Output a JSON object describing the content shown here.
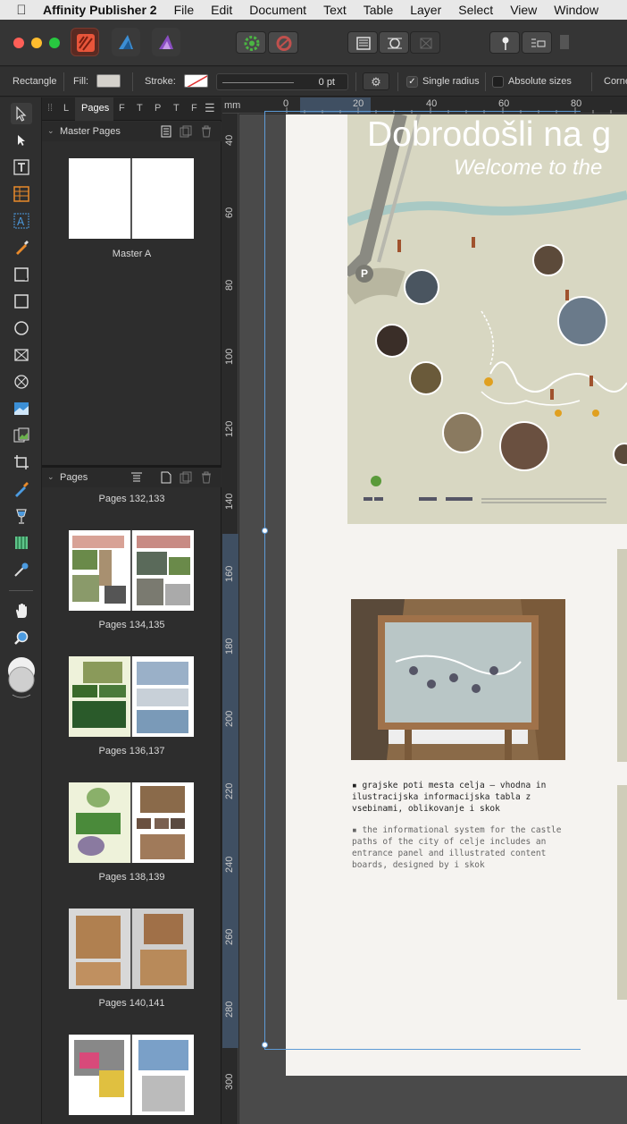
{
  "menubar": {
    "app_name": "Affinity Publisher 2",
    "items": [
      "File",
      "Edit",
      "Document",
      "Text",
      "Table",
      "Layer",
      "Select",
      "View",
      "Window"
    ]
  },
  "context_toolbar": {
    "tool_name": "Rectangle",
    "fill_label": "Fill:",
    "stroke_label": "Stroke:",
    "stroke_width": "0 pt",
    "single_radius_label": "Single radius",
    "single_radius_checked": true,
    "absolute_sizes_label": "Absolute sizes",
    "absolute_sizes_checked": false,
    "corner_label": "Corne"
  },
  "panel": {
    "tabs": [
      "L",
      "Pages",
      "F",
      "T",
      "P",
      "T",
      "F"
    ],
    "active_tab": "Pages",
    "master_section_title": "Master Pages",
    "master_name": "Master A",
    "pages_section_title": "Pages",
    "spread_labels": [
      "Pages 132,133",
      "Pages 134,135",
      "Pages 136,137",
      "Pages 138,139",
      "Pages 140,141"
    ]
  },
  "ruler": {
    "unit": "mm",
    "top_ticks": [
      "0",
      "20",
      "40",
      "60",
      "80"
    ],
    "left_ticks": [
      "40",
      "60",
      "80",
      "100",
      "120",
      "140",
      "160",
      "180",
      "200",
      "220",
      "240",
      "260",
      "280",
      "300"
    ]
  },
  "poster": {
    "title": "Dobrodošli na g",
    "subtitle": "Welcome to the",
    "parking": "P"
  },
  "caption": {
    "slovene": "▪ grajske poti mesta celja – vhodna in\nilustracijska informacijska tabla z\nvsebinami, oblikovanje  i  skok",
    "english": "▪ the informational system for the castle\npaths of the city of celje includes an\nentrance panel and illustrated content\nboards, designed by i  skok"
  },
  "colors": {
    "accent": "#5e9bd6",
    "poster_bg": "#d8d7c2",
    "page_bg": "#f5f3f0"
  }
}
